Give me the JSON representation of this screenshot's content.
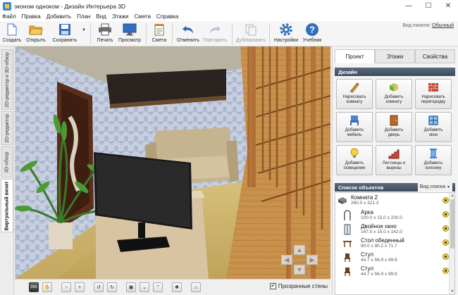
{
  "window": {
    "title": "эконом одноком - Дизайн Интерьера 3D",
    "minimize_glyph": "—",
    "maximize_glyph": "☐",
    "close_glyph": "✕"
  },
  "menu": [
    "Файл",
    "Правка",
    "Добавить",
    "План",
    "Вид",
    "Этажи",
    "Смета",
    "Справка"
  ],
  "toolbar": {
    "create": "Создать",
    "open": "Открыть",
    "save": "Сохранить",
    "print": "Печать",
    "preview": "Просмотр",
    "estimate": "Смета",
    "undo": "Отменить",
    "redo": "Повторить",
    "duplicate": "Дублировать",
    "settings": "Настройки",
    "tutorial": "Учебник",
    "panel_view_label": "Вид панели:",
    "panel_view_value": "Обычный"
  },
  "left_tabs": [
    "2D-редактор и 3D-обзор",
    "2D-редактор",
    "3D-обзор",
    "Виртуальный визит"
  ],
  "right_panel": {
    "tabs": [
      "Проект",
      "Этажи",
      "Свойства"
    ],
    "design_title": "Дизайн",
    "design_buttons": [
      [
        "Нарисовать",
        "комнату"
      ],
      [
        "Добавить",
        "комнату"
      ],
      [
        "Нарисовать",
        "перегородку"
      ],
      [
        "Добавить",
        "мебель"
      ],
      [
        "Добавить",
        "дверь"
      ],
      [
        "Добавить",
        "окно"
      ],
      [
        "Добавить",
        "освещение"
      ],
      [
        "Лестницы и",
        "вырезы"
      ],
      [
        "Добавить",
        "колонну"
      ]
    ],
    "objects_title": "Список объектов",
    "list_view_label": "Вид списка",
    "objects": [
      {
        "name": "Комната 2",
        "dims": "260.0 x 321.3",
        "icon": "room-icon"
      },
      {
        "name": "Арка",
        "dims": "100.0 x 15.0 x 200.0",
        "icon": "arch-icon"
      },
      {
        "name": "Двойное окно",
        "dims": "147.0 x 15.0 x 142.0",
        "icon": "window-icon"
      },
      {
        "name": "Стол обеденный",
        "dims": "90.0 x 90.2 x 71.7",
        "icon": "table-icon"
      },
      {
        "name": "Стул",
        "dims": "44.7 x 56.9 x 99.9",
        "icon": "chair-icon"
      },
      {
        "name": "Стул",
        "dims": "44.7 x 56.9 x 99.9",
        "icon": "chair-icon"
      }
    ]
  },
  "viewport": {
    "view_360_label": "360",
    "transparent_walls_label": "Прозрачные стены",
    "transparent_walls_checked": "✔"
  }
}
